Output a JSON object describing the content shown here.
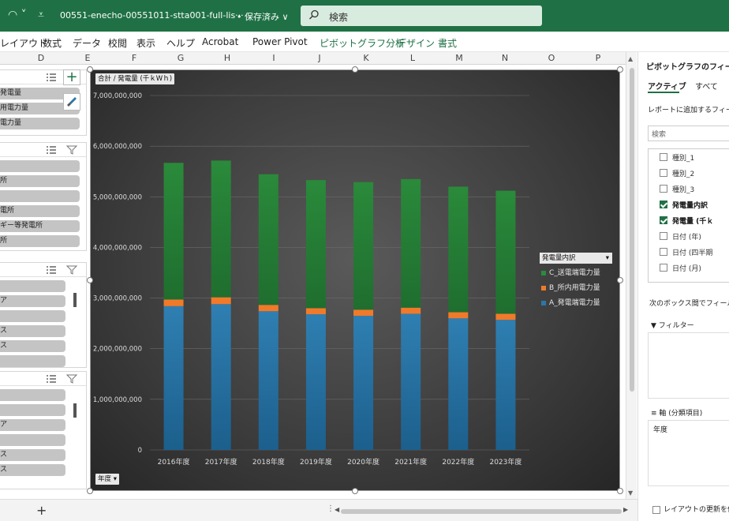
{
  "titlebar": {
    "redo_icon": "redo-icon",
    "doc_title": "00551-enecho-00551011-stta001-full-lis···",
    "save_state": "• 保存済み ∨",
    "search_placeholder": "検索"
  },
  "ribbon": {
    "tabs": [
      "レイアウト",
      "数式",
      "データ",
      "校閲",
      "表示",
      "ヘルプ",
      "Acrobat",
      "Power Pivot"
    ],
    "context_tabs": [
      "ピボットグラフ分析",
      "デザイン",
      "書式"
    ]
  },
  "columns": [
    "D",
    "E",
    "F",
    "G",
    "H",
    "I",
    "J",
    "K",
    "L",
    "M",
    "N",
    "O",
    "P"
  ],
  "slicers": [
    {
      "items": [
        "発電量",
        "用電力量",
        "電力量"
      ]
    },
    {
      "items": [
        "",
        "所",
        "",
        "電所",
        "ギー等発電所",
        "所"
      ]
    },
    {
      "items": [
        "",
        "ア",
        "",
        "ス",
        "ス",
        ""
      ]
    },
    {
      "items": [
        "",
        "",
        "ア",
        "",
        "ス",
        "ス"
      ]
    }
  ],
  "chart": {
    "field_y": "合計 / 発電量 (千ｋWｈ)",
    "field_x": "年度 ▾",
    "legend_field": "発電量内訳",
    "colors": {
      "c": "#2b8a3e",
      "b": "#f07a2a",
      "a": "#2b77a8"
    }
  },
  "chart_data": {
    "type": "bar",
    "stacked": true,
    "categories": [
      "2016年度",
      "2017年度",
      "2018年度",
      "2019年度",
      "2020年度",
      "2021年度",
      "2022年度",
      "2023年度"
    ],
    "series": [
      {
        "name": "A_発電端電力量",
        "values": [
          2840000000,
          2880000000,
          2740000000,
          2680000000,
          2650000000,
          2690000000,
          2600000000,
          2570000000
        ]
      },
      {
        "name": "B_所内用電力量",
        "values": [
          130000000,
          135000000,
          125000000,
          120000000,
          120000000,
          120000000,
          120000000,
          120000000
        ]
      },
      {
        "name": "C_送電端電力量",
        "values": [
          2700000000,
          2700000000,
          2580000000,
          2530000000,
          2520000000,
          2540000000,
          2480000000,
          2430000000
        ]
      }
    ],
    "yticks": [
      "0",
      "1,000,000,000",
      "2,000,000,000",
      "3,000,000,000",
      "4,000,000,000",
      "5,000,000,000",
      "6,000,000,000",
      "7,000,000,000"
    ],
    "ylim": [
      0,
      7000000000
    ],
    "legend": "right",
    "grid": true
  },
  "pane": {
    "title": "ピボットグラフのフィー",
    "tab_active": "アクティブ",
    "tab_all": "すべて",
    "add_fields_label": "レポートに追加するフィール",
    "search_placeholder": "検索",
    "fields": [
      {
        "label": "種別_1",
        "checked": false
      },
      {
        "label": "種別_2",
        "checked": false
      },
      {
        "label": "種別_3",
        "checked": false
      },
      {
        "label": "発電量内訳",
        "checked": true
      },
      {
        "label": "発電量 (千ｋ",
        "checked": true
      },
      {
        "label": "日付 (年)",
        "checked": false
      },
      {
        "label": "日付 (四半期",
        "checked": false
      },
      {
        "label": "日付 (月)",
        "checked": false
      }
    ],
    "drag_label": "次のボックス間でフィールド",
    "filter_label": "フィルター",
    "axis_label": "軸 (分類項目)",
    "axis_value": "年度",
    "defer_label": "レイアウトの更新を保"
  },
  "bottom": {
    "add_sheet": "+"
  }
}
